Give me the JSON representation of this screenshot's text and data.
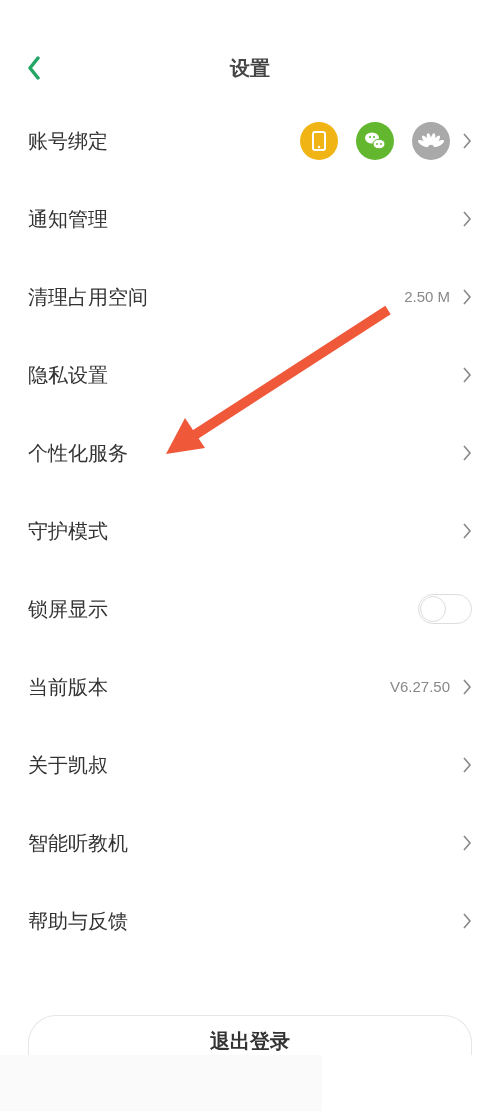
{
  "header": {
    "title": "设置"
  },
  "rows": [
    {
      "kind": "accounts",
      "label": "账号绑定"
    },
    {
      "kind": "link",
      "label": "通知管理"
    },
    {
      "kind": "link",
      "label": "清理占用空间",
      "value": "2.50 M"
    },
    {
      "kind": "link",
      "label": "隐私设置"
    },
    {
      "kind": "link",
      "label": "个性化服务"
    },
    {
      "kind": "link",
      "label": "守护模式"
    },
    {
      "kind": "toggle",
      "label": "锁屏显示",
      "on": false
    },
    {
      "kind": "link",
      "label": "当前版本",
      "value": "V6.27.50"
    },
    {
      "kind": "link",
      "label": "关于凯叔"
    },
    {
      "kind": "link",
      "label": "智能听教机"
    },
    {
      "kind": "link",
      "label": "帮助与反馈"
    }
  ],
  "logout_button": "退出登录"
}
